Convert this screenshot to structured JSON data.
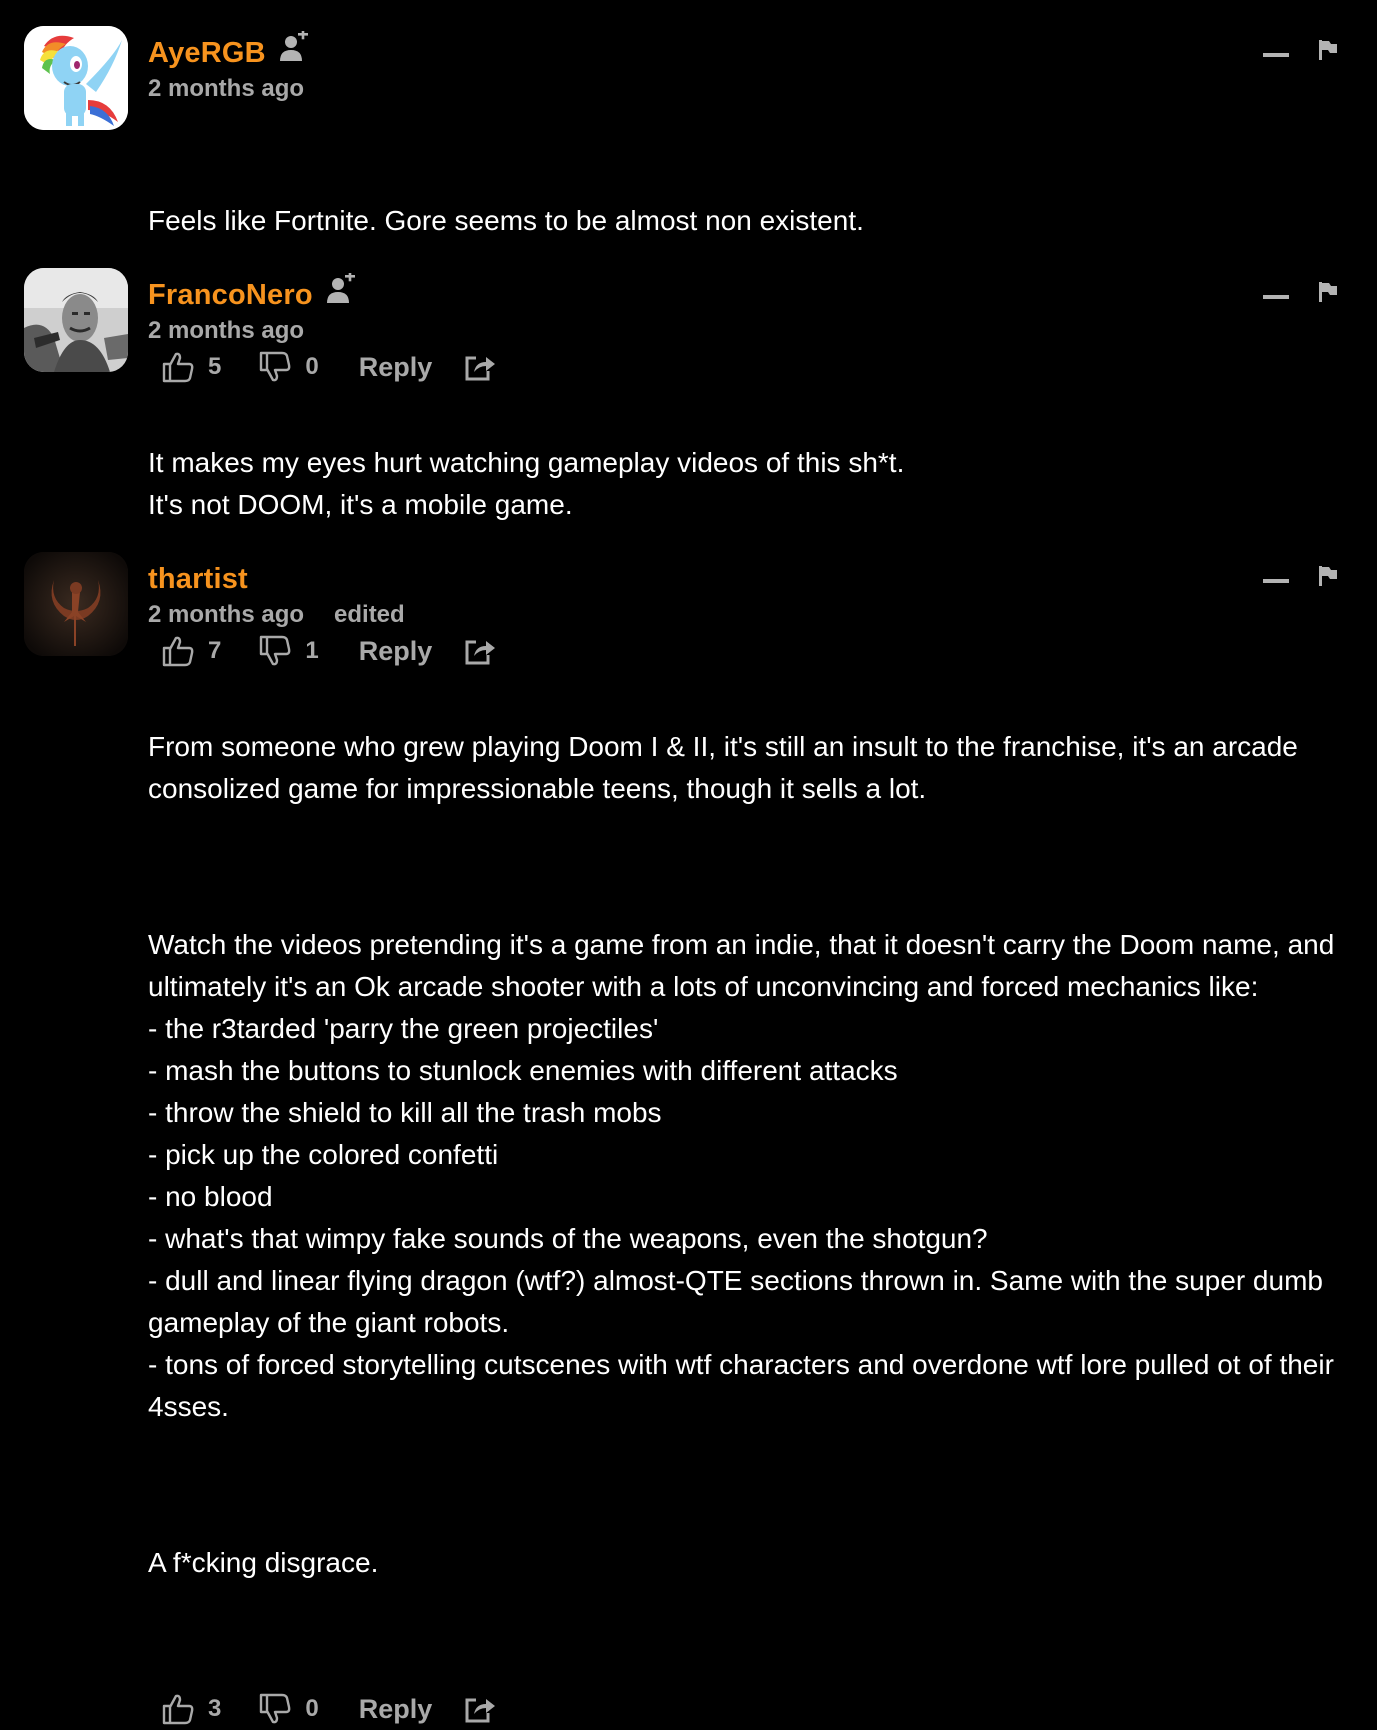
{
  "colors": {
    "background": "#000000",
    "username": "#f7931e",
    "muted": "#a9a9a9",
    "text": "#ffffff"
  },
  "icons": {
    "subscribe": "add-user-icon",
    "like": "thumbs-up-icon",
    "dislike": "thumbs-down-icon",
    "share": "share-icon",
    "collapse": "minus-icon",
    "flag": "flag-icon"
  },
  "comments": [
    {
      "username": "AyeRGB",
      "time": "2 months ago",
      "edited": "",
      "paragraphs": [
        "Feels like Fortnite. Gore seems to be almost non existent."
      ],
      "likes": "5",
      "dislikes": "0",
      "reply_label": "Reply"
    },
    {
      "username": "FrancoNero",
      "time": "2 months ago",
      "edited": "",
      "paragraphs": [
        "It makes my eyes hurt watching gameplay videos of this sh*t.\nIt's not DOOM, it's a mobile game."
      ],
      "likes": "7",
      "dislikes": "1",
      "reply_label": "Reply"
    },
    {
      "username": "thartist",
      "time": "2 months ago",
      "edited": "edited",
      "paragraphs": [
        "From someone who grew playing Doom I & II, it's still an insult to the franchise, it's an arcade consolized game for impressionable teens, though it sells a lot.",
        "Watch the videos pretending it's a game from an indie, that it doesn't carry the Doom name, and ultimately it's an Ok arcade shooter with a lots of unconvincing and forced mechanics like:\n- the r3tarded 'parry the green projectiles'\n- mash the buttons to stunlock enemies with different attacks\n- throw the shield to kill all the trash mobs\n- pick up the colored confetti\n- no blood\n- what's that wimpy fake sounds of the weapons, even the shotgun?\n- dull and linear flying dragon (wtf?) almost-QTE sections thrown in. Same with the super dumb gameplay of the giant robots.\n- tons of forced storytelling cutscenes with wtf characters and overdone wtf lore pulled ot of their 4sses.",
        "A f*cking disgrace."
      ],
      "likes": "3",
      "dislikes": "0",
      "reply_label": "Reply"
    }
  ]
}
